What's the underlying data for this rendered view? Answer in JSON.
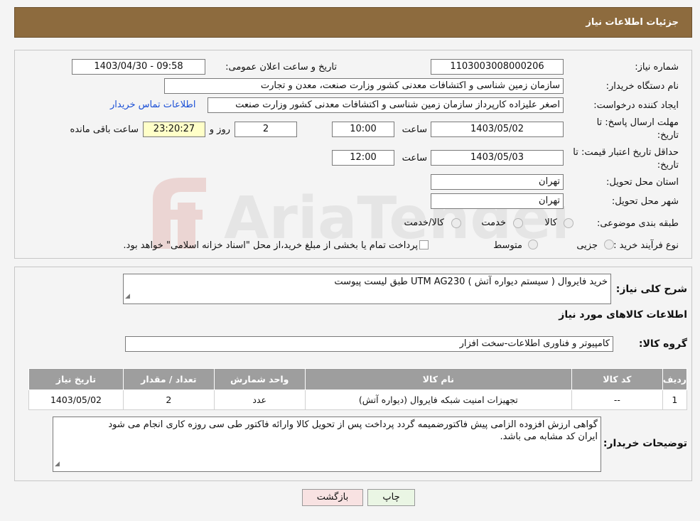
{
  "header": {
    "title": "جزئیات اطلاعات نیاز"
  },
  "form": {
    "need_number_label": "شماره نیاز:",
    "need_number": "1103003008000206",
    "announce_label": "تاریخ و ساعت اعلان عمومی:",
    "announce_value": "1403/04/30 - 09:58",
    "buyer_org_label": "نام دستگاه خریدار:",
    "buyer_org": "سازمان زمین شناسی و اکتشافات معدنی کشور وزارت صنعت، معدن و تجارت",
    "creator_label": "ایجاد کننده درخواست:",
    "creator": "اصغر علیزاده کارپرداز سازمان زمین شناسی و اکتشافات معدنی کشور وزارت صنعت",
    "contact_link": "اطلاعات تماس خریدار",
    "deadline_label_1": "مهلت ارسال پاسخ: تا",
    "deadline_label_2": "تاریخ:",
    "deadline_date": "1403/05/02",
    "time_label": "ساعت",
    "deadline_time": "10:00",
    "remaining_days": "2",
    "days_label": "روز و",
    "remaining_time": "23:20:27",
    "remaining_label": "ساعت باقی مانده",
    "validity_label_1": "حداقل تاریخ اعتبار قیمت: تا",
    "validity_label_2": "تاریخ:",
    "validity_date": "1403/05/03",
    "validity_time": "12:00",
    "province_label": "استان محل تحویل:",
    "province": "تهران",
    "city_label": "شهر محل تحویل:",
    "city": "تهران",
    "category_label": "طبقه بندی موضوعی:",
    "category_options": [
      "کالا",
      "خدمت",
      "کالا/خدمت"
    ],
    "process_label": "نوع فرآیند خرید :",
    "process_options": [
      "جزیی",
      "متوسط"
    ],
    "payment_note": "پرداخت تمام یا بخشی از مبلغ خرید،از محل \"اسناد خزانه اسلامی\" خواهد بود."
  },
  "details": {
    "summary_label": "شرح کلی نیاز:",
    "summary": "خرید فایروال ( سیستم دیواره آتش ) UTM AG230 طبق لیست پیوست",
    "goods_info_title": "اطلاعات کالاهای مورد نیاز",
    "goods_group_label": "گروه کالا:",
    "goods_group": "کامپیوتر و فناوری اطلاعات-سخت افزار",
    "table": {
      "headers": [
        "ردیف",
        "کد کالا",
        "نام کالا",
        "واحد شمارش",
        "تعداد / مقدار",
        "تاریخ نیاز"
      ],
      "rows": [
        [
          "1",
          "--",
          "تجهیزات امنیت شبکه فایروال (دیواره آتش)",
          "عدد",
          "2",
          "1403/05/02"
        ]
      ]
    },
    "buyer_notes_label": "توضیحات خریدار:",
    "buyer_notes_line1": "گواهی ارزش افزوده الزامی پیش فاکتورضمیمه گردد پرداخت پس از تحویل کالا وارائه فاکتور طی سی روزه کاری انجام می شود",
    "buyer_notes_line2": "ایران کد مشابه می باشد."
  },
  "buttons": {
    "print": "چاپ",
    "back": "بازگشت"
  },
  "colors": {
    "header_bg": "#8d6b3e",
    "table_header_bg": "#9e9e9e",
    "link": "#1a4fd6",
    "watermark": "#c0392b"
  }
}
